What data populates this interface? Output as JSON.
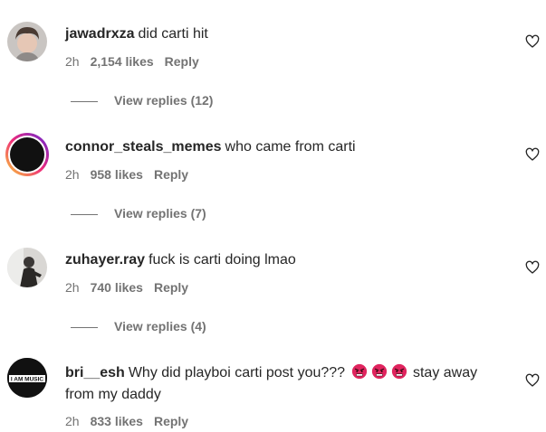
{
  "comments": [
    {
      "username": "jawadrxza",
      "text": "did carti hit",
      "time": "2h",
      "likes": "2,154 likes",
      "reply": "Reply",
      "view_replies": "View replies (12)"
    },
    {
      "username": "connor_steals_memes",
      "text": "who came from carti",
      "time": "2h",
      "likes": "958 likes",
      "reply": "Reply",
      "view_replies": "View replies (7)"
    },
    {
      "username": "zuhayer.ray",
      "text": "fuck is carti doing lmao",
      "time": "2h",
      "likes": "740 likes",
      "reply": "Reply",
      "view_replies": "View replies (4)"
    },
    {
      "username": "bri__esh",
      "text_before_emoji": "Why did playboi carti post you???",
      "text_after_emoji": "stay away",
      "text_line2": "from my daddy",
      "emojis": [
        "angry-face-emoji",
        "angry-face-emoji",
        "angry-face-emoji"
      ],
      "time": "2h",
      "likes": "833 likes",
      "reply": "Reply",
      "avatar_text": "I AM MUSIC"
    }
  ],
  "icons": {
    "like": "heart-outline-icon"
  },
  "colors": {
    "text": "#262626",
    "secondary": "#737373",
    "story_ring_start": "#f9ce34",
    "story_ring_mid": "#ee2a7b",
    "story_ring_end": "#6228d7",
    "emoji_red": "#e0245e"
  }
}
